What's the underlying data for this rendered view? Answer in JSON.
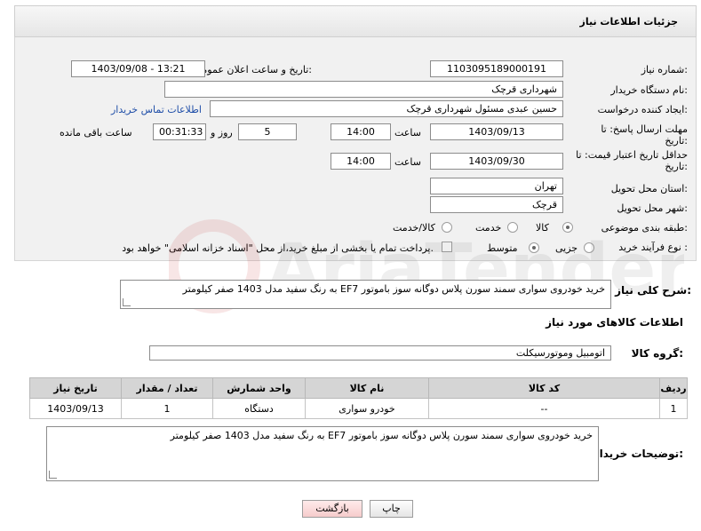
{
  "header": {
    "title": "جزئیات اطلاعات نیاز"
  },
  "fields": {
    "need_number_label": "شماره نیاز:",
    "need_number": "1103095189000191",
    "announce_label": "تاریخ و ساعت اعلان عمومی:",
    "announce_value": "1403/09/08 - 13:21",
    "buyer_org_label": "نام دستگاه خریدار:",
    "buyer_org": "شهرداری قرچک",
    "requester_label": "ایجاد کننده درخواست:",
    "requester": "حسین عبدی مسئول شهرداری قرچک",
    "contact_link": "اطلاعات تماس خریدار",
    "deadline_label_1": "مهلت ارسال پاسخ: تا",
    "deadline_label_2": "تاریخ:",
    "deadline_date": "1403/09/13",
    "time_label": "ساعت",
    "deadline_time": "14:00",
    "days_value": "5",
    "days_label": "روز و",
    "remaining_time": "00:31:33",
    "remaining_label": "ساعت باقی مانده",
    "validity_label_1": "حداقل تاریخ اعتبار قیمت: تا",
    "validity_label_2": "تاریخ:",
    "validity_date": "1403/09/30",
    "validity_time": "14:00",
    "province_label": "استان محل تحویل:",
    "province": "تهران",
    "city_label": "شهر محل تحویل:",
    "city": "قرچک",
    "category_label": "طبقه بندی موضوعی:",
    "category_options": [
      "کالا",
      "خدمت",
      "کالا/خدمت"
    ],
    "process_label": "نوع فرآیند خرید :",
    "process_options": [
      "جزیی",
      "متوسط"
    ],
    "payment_note": "پرداخت تمام یا بخشی از مبلغ خرید،از محل \"اسناد خزانه اسلامی\" خواهد بود."
  },
  "description": {
    "label": "شرح کلی نیاز:",
    "text": "خرید خودروی سواری سمند سورن پلاس دوگانه سوز باموتور EF7 به رنگ سفید مدل 1403 صفر کیلومتر"
  },
  "goods": {
    "section_title": "اطلاعات کالاهای مورد نیاز",
    "group_label": "گروه کالا:",
    "group_value": "اتومبیل وموتورسیکلت",
    "columns": [
      "ردیف",
      "کد کالا",
      "نام کالا",
      "واحد شمارش",
      "تعداد / مقدار",
      "تاریخ نیاز"
    ],
    "rows": [
      [
        "1",
        "--",
        "خودرو سواری",
        "دستگاه",
        "1",
        "1403/09/13"
      ]
    ]
  },
  "buyer_notes": {
    "label": "توضیحات خریدار:",
    "text": "خرید خودروی سواری سمند سورن پلاس دوگانه سوز باموتور EF7 به رنگ سفید مدل 1403 صفر کیلومتر"
  },
  "buttons": {
    "print": "چاپ",
    "back": "بازگشت"
  },
  "colors": {
    "link": "#1f4ea8",
    "back_button": "#f6cccc",
    "header_bg": "#e9e9e9"
  }
}
